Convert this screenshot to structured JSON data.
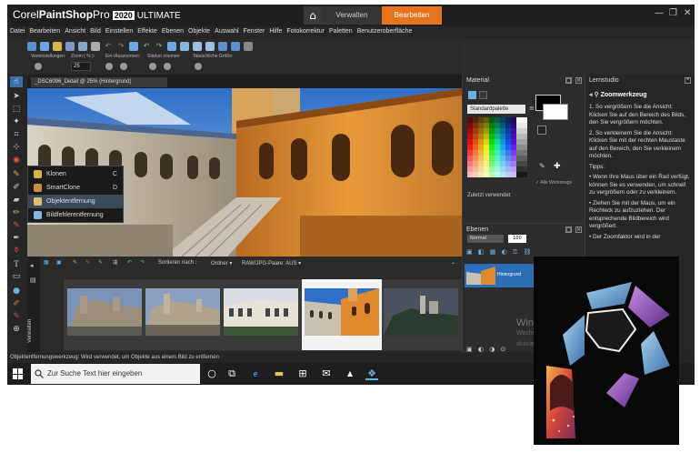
{
  "app": {
    "brand_name": "Corel PaintShop Pro",
    "brand_part1": "Corel",
    "brand_part2": "PaintShop",
    "brand_part3": "Pro",
    "year": "2020",
    "edition": "ULTIMATE"
  },
  "nav_tabs": {
    "manage": "Verwalten",
    "edit": "Bearbeiten"
  },
  "window_controls": {
    "minimize": "—",
    "restore": "❐",
    "close": "✕"
  },
  "menu": [
    "Datei",
    "Bearbeiten",
    "Ansicht",
    "Bild",
    "Einstellen",
    "Effekte",
    "Ebenen",
    "Objekte",
    "Auswahl",
    "Fenster",
    "Hilfe",
    "Fotokorrektur",
    "Paletten",
    "Benutzeroberfläche"
  ],
  "options": {
    "presets_label": "Voreinstellungen:",
    "zoom_label": "Zoom ( % ):",
    "zoom_value": "25",
    "zoom_inout_label": "Ein-/Auszoomen:",
    "zoom_more_label": "Stärker zoomen:",
    "actual_size_label": "Tatsächliche Größe:"
  },
  "document": {
    "tab_label": "_DSC6096_Detail @ 25% (Hintergrund)"
  },
  "flyout": {
    "items": [
      {
        "label": "Klonen",
        "key": "C"
      },
      {
        "label": "SmartClone",
        "key": "D"
      },
      {
        "label": "Objektentfernung",
        "key": ""
      },
      {
        "label": "Bildfehlerentfernung",
        "key": ""
      }
    ]
  },
  "organizer": {
    "vertical_label": "Verwalten",
    "sort_label": "Sortieren nach :",
    "sort_value": "Ordner ▾",
    "raw_pairs": "RAW/JPG-Paare: AUS ▾"
  },
  "material": {
    "title": "Material",
    "palette_select": "Standardpalette",
    "all_tools": "Alle Werkzeuge",
    "recently_used": "Zuletzt verwendet"
  },
  "layers": {
    "title": "Ebenen",
    "blend_mode": "Normal",
    "opacity": "100",
    "layer_name": "Hintergrund"
  },
  "watermark": {
    "line1": "Windo",
    "line2": "Wechse",
    "line3": "aktivie"
  },
  "learn": {
    "title": "Lernstudio",
    "heading": "Zoomwerkzeug",
    "steps": [
      "1. So vergrößern Sie die Ansicht: Klicken Sie auf den Bereich des Bilds, den Sie vergrößern möchten.",
      "2. So verkleinern Sie die Ansicht: Klicken Sie mit der rechten Maustaste auf den Bereich, den Sie verkleinern möchten."
    ],
    "tips_label": "Tipps:",
    "tips": [
      "• Wenn Ihre Maus über ein Rad verfügt, können Sie es verwenden, um schnell zu vergrößern oder zu verkleinern.",
      "• Ziehen Sie mit der Maus, um ein Rechteck zu aufzuziehen. Der entsprechende Bildbereich wird vergrößert.",
      "• Der Zoomfaktor wird in der"
    ]
  },
  "status": {
    "text": "Objektentfernungswerkzeug: Wird verwendet, um Objekte aus einem Bild zu entfernen"
  },
  "taskbar": {
    "search_placeholder": "Zur Suche Text hier eingeben"
  },
  "colors": {
    "accent": "#e8731f",
    "layer_selected": "#2a6fb5",
    "flyout_selected": "#3b4a5a"
  }
}
